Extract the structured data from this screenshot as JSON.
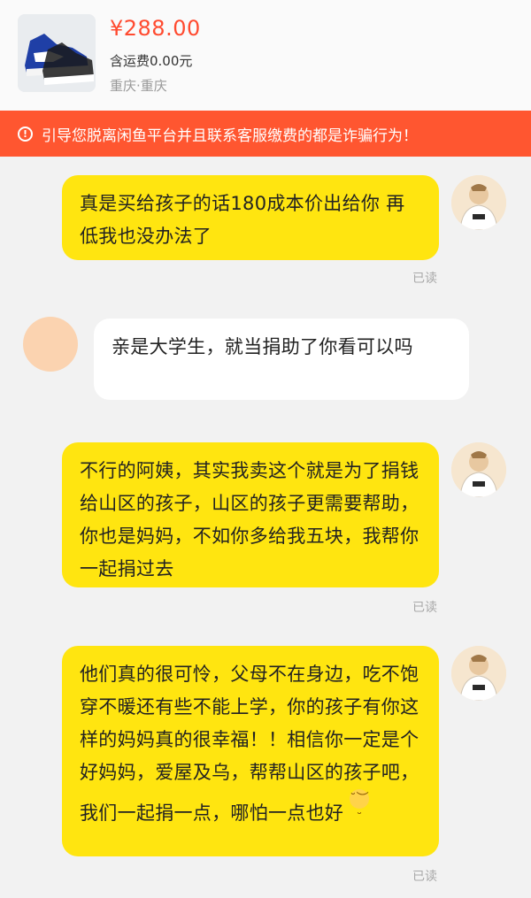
{
  "product": {
    "price": "¥288.00",
    "shipping": "含运费0.00元",
    "location": "重庆·重庆",
    "thumbnail_icon": "sneaker-image"
  },
  "warning": {
    "text": "引导您脱离闲鱼平台并且联系客服缴费的都是诈骗行为！",
    "color": "#ff5630"
  },
  "messages": [
    {
      "sender": "me",
      "text": "真是买给孩子的话180成本价出给你 再低我也没办法了",
      "status": "已读"
    },
    {
      "sender": "them",
      "text": "亲是大学生，就当捐助了你看可以吗"
    },
    {
      "sender": "me",
      "text": "不行的阿姨，其实我卖这个就是为了捐钱给山区的孩子，山区的孩子更需要帮助，你也是妈妈，不如你多给我五块，我帮你一起捐过去",
      "status": "已读"
    },
    {
      "sender": "me",
      "text": "他们真的很可怜，父母不在身边，吃不饱穿不暖还有些不能上学，你的孩子有你这样的妈妈真的很幸福！！相信你一定是个好妈妈，爱屋及乌，帮帮山区的孩子吧，我们一起捐一点，哪怕一点也好",
      "status": "已读",
      "emoji": "pensive-emoji"
    }
  ],
  "colors": {
    "my_bubble": "#ffe510",
    "their_bubble": "#ffffff"
  }
}
